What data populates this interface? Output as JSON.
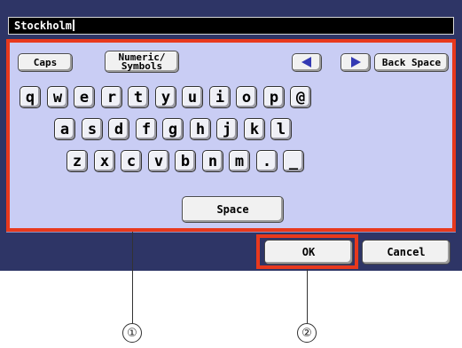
{
  "input": {
    "value": "Stockholm"
  },
  "toolbar": {
    "caps": "Caps",
    "numeric_line1": "Numeric/",
    "numeric_line2": "Symbols",
    "back_space": "Back Space",
    "left_arrow_icon": "arrow-left-icon",
    "right_arrow_icon": "arrow-right-icon"
  },
  "rows": [
    [
      "q",
      "w",
      "e",
      "r",
      "t",
      "y",
      "u",
      "i",
      "o",
      "p",
      "@"
    ],
    [
      "a",
      "s",
      "d",
      "f",
      "g",
      "h",
      "j",
      "k",
      "l"
    ],
    [
      "z",
      "x",
      "c",
      "v",
      "b",
      "n",
      "m",
      ".",
      "_"
    ]
  ],
  "space_label": "Space",
  "footer": {
    "ok": "OK",
    "cancel": "Cancel"
  },
  "markers": [
    "①",
    "②"
  ],
  "colors": {
    "frame": "#2e3566",
    "panel": "#c9cdf4",
    "highlight": "#e8391d",
    "arrow": "#3339b3"
  }
}
